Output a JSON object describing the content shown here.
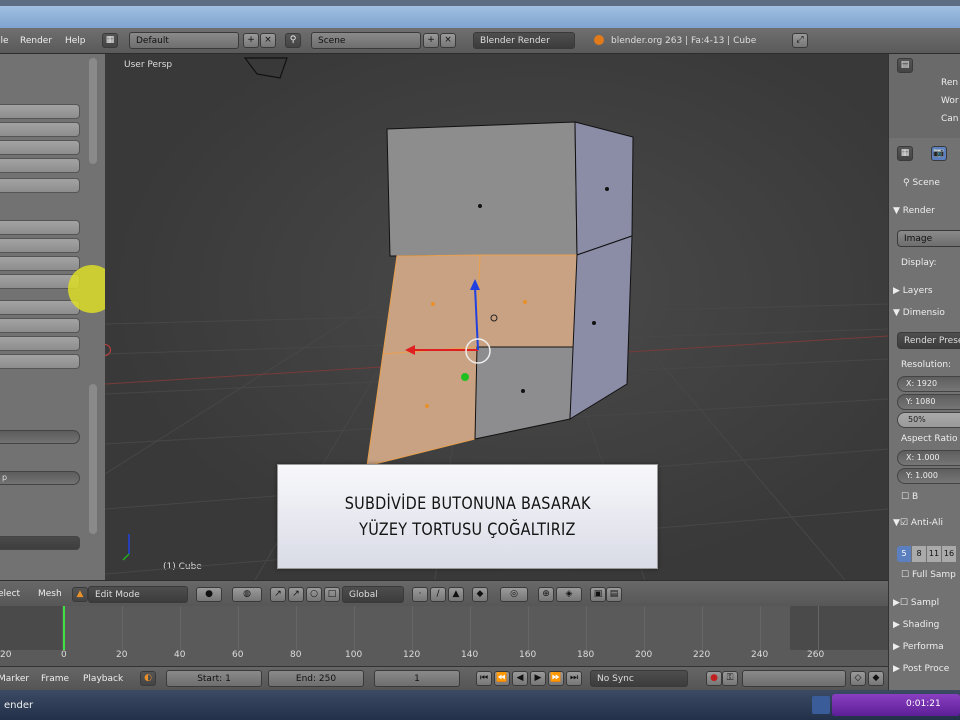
{
  "menubar": {
    "items": [
      "ile",
      "Render",
      "Help"
    ],
    "layout": "Default",
    "scene": "Scene",
    "engine": "Blender Render",
    "info": "blender.org 263 | Fa:4-13 | Cube"
  },
  "viewport": {
    "view_label": "User Persp",
    "object_label": "(1) Cube"
  },
  "caption": {
    "line1": "SUBDİVİDE BUTONUNA BASARAK",
    "line2": "YÜZEY TORTUSU ÇOĞALTIRIZ"
  },
  "left_panel": {
    "slider1": "",
    "slider2": "p"
  },
  "vp_header": {
    "select": "elect",
    "mesh": "Mesh",
    "mode": "Edit Mode",
    "orientation": "Global"
  },
  "timeline": {
    "ticks": [
      "20",
      "0",
      "20",
      "40",
      "60",
      "80",
      "100",
      "120",
      "140",
      "160",
      "180",
      "200",
      "220",
      "240",
      "260"
    ],
    "current_frame": 1
  },
  "tl_bottom": {
    "marker": "Marker",
    "frame": "Frame",
    "playback": "Playback",
    "start": "Start: 1",
    "end": "End: 250",
    "current": "1",
    "sync": "No Sync"
  },
  "right_panel": {
    "outliner": [
      "Ren",
      "Wor",
      "Can"
    ],
    "scene_tab": "Scene",
    "render": "Render",
    "image_btn": "Image",
    "display": "Display:",
    "layers": "Layers",
    "dimensions": "Dimensio",
    "render_presets": "Render Prese",
    "resolution": "Resolution:",
    "res_x": "X: 1920",
    "res_y": "Y: 1080",
    "res_pct": "50%",
    "aspect": "Aspect Ratio",
    "asp_x": "X: 1.000",
    "asp_y": "Y: 1.000",
    "border": "B",
    "antialias": "Anti-Ali",
    "aa_values": [
      "5",
      "8",
      "11",
      "16"
    ],
    "full_sample": "Full Samp",
    "sampled": "Sampl",
    "shading": "Shading",
    "performance": "Performa",
    "post": "Post Proce"
  },
  "taskbar": {
    "app": "ender",
    "time": "0:01:21"
  }
}
